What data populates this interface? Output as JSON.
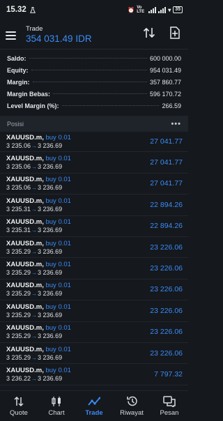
{
  "status_bar": {
    "time": "15.32",
    "net_label": "Vo LTE",
    "battery": "35"
  },
  "header": {
    "title": "Trade",
    "balance": "354 031.49 IDR"
  },
  "summary": [
    {
      "label": "Saldo:",
      "value": "600 000.00"
    },
    {
      "label": "Equity:",
      "value": "954 031.49"
    },
    {
      "label": "Margin:",
      "value": "357 860.77"
    },
    {
      "label": "Margin Bebas:",
      "value": "596 170.72"
    },
    {
      "label": "Level Margin (%):",
      "value": "266.59"
    }
  ],
  "positions_section": {
    "label": "Posisi",
    "more": "•••"
  },
  "positions": [
    {
      "symbol": "XAUUSD.m,",
      "action": "buy 0.01",
      "open": "3 235.06",
      "current": "3 236.69",
      "profit": "27 041.77"
    },
    {
      "symbol": "XAUUSD.m,",
      "action": "buy 0.01",
      "open": "3 235.06",
      "current": "3 236.69",
      "profit": "27 041.77"
    },
    {
      "symbol": "XAUUSD.m,",
      "action": "buy 0.01",
      "open": "3 235.06",
      "current": "3 236.69",
      "profit": "27 041.77"
    },
    {
      "symbol": "XAUUSD.m,",
      "action": "buy 0.01",
      "open": "3 235.31",
      "current": "3 236.69",
      "profit": "22 894.26"
    },
    {
      "symbol": "XAUUSD.m,",
      "action": "buy 0.01",
      "open": "3 235.31",
      "current": "3 236.69",
      "profit": "22 894.26"
    },
    {
      "symbol": "XAUUSD.m,",
      "action": "buy 0.01",
      "open": "3 235.29",
      "current": "3 236.69",
      "profit": "23 226.06"
    },
    {
      "symbol": "XAUUSD.m,",
      "action": "buy 0.01",
      "open": "3 235.29",
      "current": "3 236.69",
      "profit": "23 226.06"
    },
    {
      "symbol": "XAUUSD.m,",
      "action": "buy 0.01",
      "open": "3 235.29",
      "current": "3 236.69",
      "profit": "23 226.06"
    },
    {
      "symbol": "XAUUSD.m,",
      "action": "buy 0.01",
      "open": "3 235.29",
      "current": "3 236.69",
      "profit": "23 226.06"
    },
    {
      "symbol": "XAUUSD.m,",
      "action": "buy 0.01",
      "open": "3 235.29",
      "current": "3 236.69",
      "profit": "23 226.06"
    },
    {
      "symbol": "XAUUSD.m,",
      "action": "buy 0.01",
      "open": "3 235.29",
      "current": "3 236.69",
      "profit": "23 226.06"
    },
    {
      "symbol": "XAUUSD.m,",
      "action": "buy 0.01",
      "open": "3 236.22",
      "current": "3 236.69",
      "profit": "7 797.32"
    }
  ],
  "tabs": [
    {
      "label": "Quote",
      "icon": "quote-arrows-icon",
      "active": false
    },
    {
      "label": "Chart",
      "icon": "candlestick-icon",
      "active": false
    },
    {
      "label": "Trade",
      "icon": "trade-line-icon",
      "active": true
    },
    {
      "label": "Riwayat",
      "icon": "history-clock-icon",
      "active": false
    },
    {
      "label": "Pesan",
      "icon": "message-icon",
      "active": false
    }
  ],
  "colors": {
    "accent": "#3b8cf5",
    "background": "#15181d",
    "section_bg": "#1f232a"
  }
}
